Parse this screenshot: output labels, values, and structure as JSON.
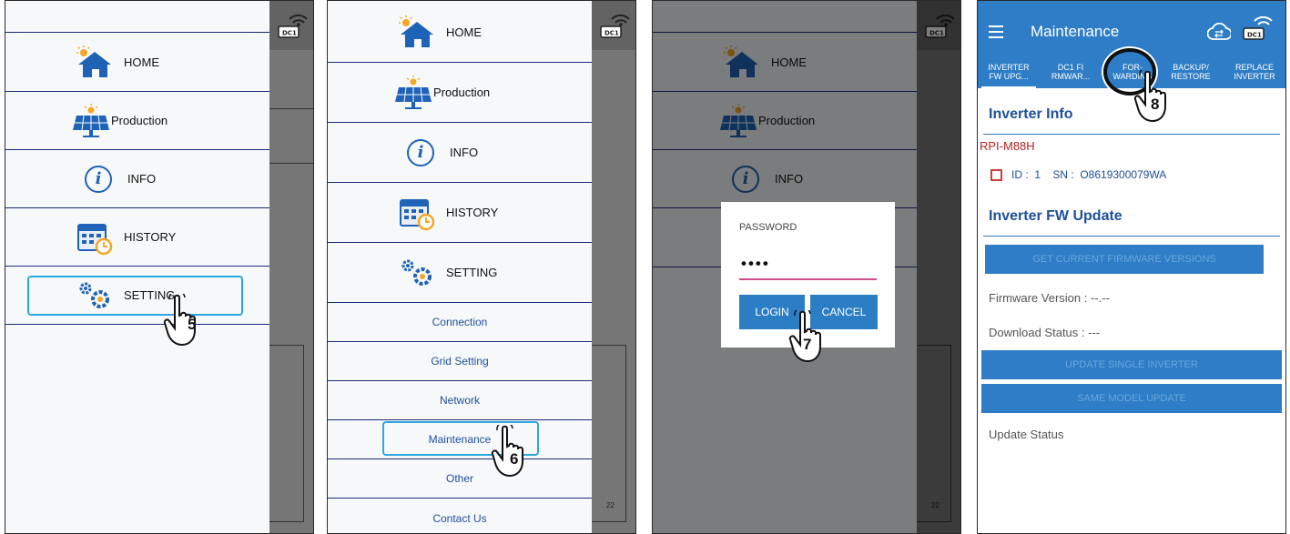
{
  "panel1": {
    "menu": [
      {
        "label": "HOME",
        "icon": "home-icon"
      },
      {
        "label": "Production",
        "icon": "solar-panel-icon"
      },
      {
        "label": "INFO",
        "icon": "info-icon"
      },
      {
        "label": "HISTORY",
        "icon": "calendar-clock-icon"
      },
      {
        "label": "SETTING",
        "icon": "gears-icon"
      }
    ],
    "step": "5"
  },
  "panel2": {
    "menu": [
      {
        "label": "HOME",
        "icon": "home-icon"
      },
      {
        "label": "Production",
        "icon": "solar-panel-icon"
      },
      {
        "label": "INFO",
        "icon": "info-icon"
      },
      {
        "label": "HISTORY",
        "icon": "calendar-clock-icon"
      },
      {
        "label": "SETTING",
        "icon": "gears-icon"
      }
    ],
    "submenu": [
      "Connection",
      "Grid Setting",
      "Network",
      "Maintenance",
      "Other",
      "Contact Us"
    ],
    "step": "6",
    "bg_tick": "22"
  },
  "panel3": {
    "menu": [
      {
        "label": "HOME",
        "icon": "home-icon"
      },
      {
        "label": "Production",
        "icon": "solar-panel-icon"
      },
      {
        "label": "INFO",
        "icon": "info-icon"
      }
    ],
    "dialog": {
      "title": "PASSWORD",
      "value": "••••",
      "login": "LOGIN",
      "cancel": "CANCEL"
    },
    "step": "7",
    "bg_tick": "22"
  },
  "panel4": {
    "title": "Maintenance",
    "tabs": [
      {
        "line1": "INVERTER",
        "line2": "FW UPG..."
      },
      {
        "line1": "DC1 FI",
        "line2": "RMWAR..."
      },
      {
        "line1": "FOR-",
        "line2": "WARDING"
      },
      {
        "line1": "BACKUP/",
        "line2": "RESTORE"
      },
      {
        "line1": "REPLACE",
        "line2": "INVERTER"
      }
    ],
    "inverter_info_heading": "Inverter Info",
    "model": "RPI-M88H",
    "device": "ID :  1    SN :  O8619300079WA",
    "fw_update_heading": "Inverter FW Update",
    "btn_get_versions": "GET CURRENT FIRMWARE VERSIONS",
    "firmware_version": "Firmware Version :  --.--",
    "download_status": "Download Status :  ---",
    "btn_update_single": "UPDATE SINGLE INVERTER",
    "btn_same_model": "SAME MODEL UPDATE",
    "update_status": "Update Status",
    "step": "8"
  },
  "colors": {
    "accent": "#2e7dc6",
    "highlight": "#29a8df",
    "model_red": "#b22222",
    "divider": "#1b2a7a"
  },
  "bg_tick": "22"
}
